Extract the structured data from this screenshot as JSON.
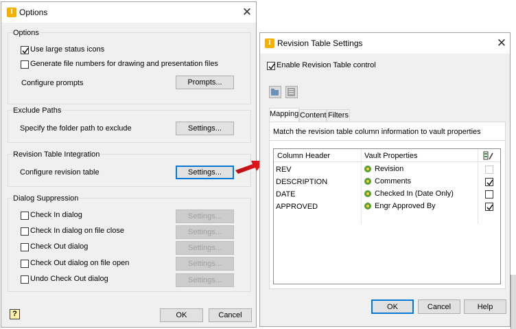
{
  "options_dialog": {
    "title": "Options",
    "options_group": {
      "label": "Options",
      "large_icons_label": "Use large status icons",
      "large_icons_checked": true,
      "file_numbers_label": "Generate file numbers for drawing and presentation files",
      "file_numbers_checked": false,
      "configure_prompts_label": "Configure prompts",
      "prompts_button": "Prompts..."
    },
    "exclude_group": {
      "label": "Exclude Paths",
      "description": "Specify the folder  path to exclude",
      "settings_button": "Settings..."
    },
    "revision_group": {
      "label": "Revision Table Integration",
      "description": "Configure revision table",
      "settings_button": "Settings..."
    },
    "suppression_group": {
      "label": "Dialog Suppression",
      "items": [
        {
          "label": "Check In dialog",
          "checked": false,
          "button": "Settings..."
        },
        {
          "label": "Check In dialog on file close",
          "checked": false,
          "button": "Settings..."
        },
        {
          "label": "Check Out dialog",
          "checked": false,
          "button": "Settings..."
        },
        {
          "label": "Check Out dialog on file open",
          "checked": false,
          "button": "Settings..."
        },
        {
          "label": "Undo Check Out dialog",
          "checked": false,
          "button": "Settings..."
        }
      ]
    },
    "ok_button": "OK",
    "cancel_button": "Cancel"
  },
  "revision_dialog": {
    "title": "Revision Table Settings",
    "enable_label": "Enable Revision Table control",
    "enable_checked": true,
    "tabs": [
      "Mappings",
      "Content",
      "Filters"
    ],
    "active_tab": "Mappings",
    "description": "Match the revision table column information to vault properties",
    "columns": [
      "Column Header",
      "Vault Properties"
    ],
    "rows": [
      {
        "header": "REV",
        "property": "Revision",
        "checked": false,
        "disabled": true
      },
      {
        "header": "DESCRIPTION",
        "property": "Comments",
        "checked": true,
        "disabled": false
      },
      {
        "header": "DATE",
        "property": "Checked In (Date Only)",
        "checked": false,
        "disabled": false
      },
      {
        "header": "APPROVED",
        "property": "Engr Approved By",
        "checked": true,
        "disabled": false
      }
    ],
    "ok_button": "OK",
    "cancel_button": "Cancel",
    "help_button": "Help"
  },
  "colors": {
    "accent": "#0078d7",
    "arrow": "#e8141b",
    "icon_orange": "#f5b000"
  }
}
